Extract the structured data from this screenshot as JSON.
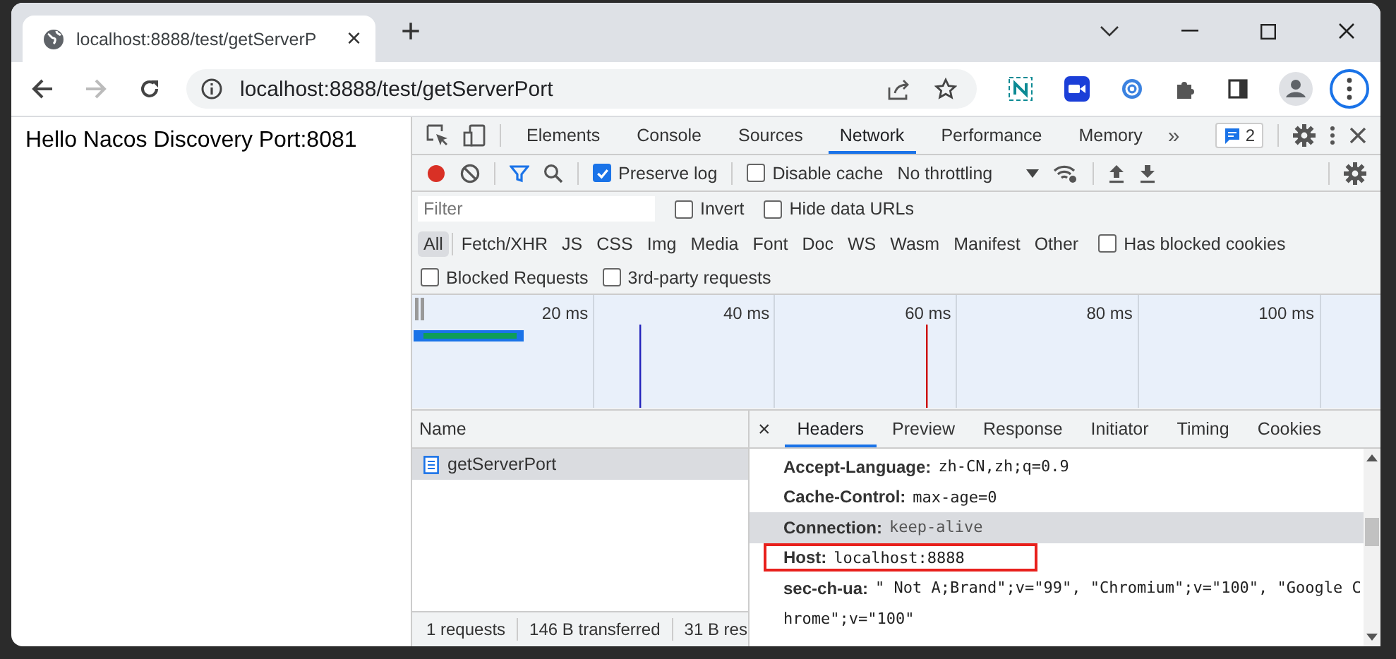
{
  "browser_tab": {
    "title": "localhost:8888/test/getServerP",
    "close": "×"
  },
  "new_tab": "+",
  "address": "localhost:8888/test/getServerPort",
  "page_text": "Hello Nacos Discovery Port:8081",
  "devtools": {
    "tabs": [
      {
        "label": "Elements",
        "selected": false
      },
      {
        "label": "Console",
        "selected": false
      },
      {
        "label": "Sources",
        "selected": false
      },
      {
        "label": "Network",
        "selected": true
      },
      {
        "label": "Performance",
        "selected": false
      },
      {
        "label": "Memory",
        "selected": false
      }
    ],
    "more": "»",
    "issues_count": "2",
    "recording": true,
    "preserve_log": {
      "label": "Preserve log",
      "checked": true
    },
    "disable_cache": {
      "label": "Disable cache",
      "checked": false
    },
    "throttling": "No throttling",
    "filter": {
      "placeholder": "Filter"
    },
    "invert": {
      "label": "Invert",
      "checked": false
    },
    "hide_data_urls": {
      "label": "Hide data URLs",
      "checked": false
    },
    "type_filters": [
      {
        "label": "All",
        "selected": true
      },
      {
        "label": "Fetch/XHR",
        "selected": false
      },
      {
        "label": "JS",
        "selected": false
      },
      {
        "label": "CSS",
        "selected": false
      },
      {
        "label": "Img",
        "selected": false
      },
      {
        "label": "Media",
        "selected": false
      },
      {
        "label": "Font",
        "selected": false
      },
      {
        "label": "Doc",
        "selected": false
      },
      {
        "label": "WS",
        "selected": false
      },
      {
        "label": "Wasm",
        "selected": false
      },
      {
        "label": "Manifest",
        "selected": false
      },
      {
        "label": "Other",
        "selected": false
      }
    ],
    "has_blocked_cookies": {
      "label": "Has blocked cookies",
      "checked": false
    },
    "blocked_requests": {
      "label": "Blocked Requests",
      "checked": false
    },
    "third_party": {
      "label": "3rd-party requests",
      "checked": false
    },
    "timeline_ticks": [
      "20 ms",
      "40 ms",
      "60 ms",
      "80 ms",
      "100 ms"
    ],
    "name_column": "Name",
    "requests": [
      {
        "name": "getServerPort",
        "selected": true
      }
    ],
    "detail_close": "×",
    "detail_tabs": [
      {
        "label": "Headers",
        "selected": true
      },
      {
        "label": "Preview",
        "selected": false
      },
      {
        "label": "Response",
        "selected": false
      },
      {
        "label": "Initiator",
        "selected": false
      },
      {
        "label": "Timing",
        "selected": false
      },
      {
        "label": "Cookies",
        "selected": false
      }
    ],
    "headers": [
      {
        "name": "Accept-Language:",
        "value": "zh-CN,zh;q=0.9",
        "hovered": false,
        "outlined": false
      },
      {
        "name": "Cache-Control:",
        "value": "max-age=0",
        "hovered": false,
        "outlined": false
      },
      {
        "name": "Connection:",
        "value": "keep-alive",
        "hovered": true,
        "outlined": false
      },
      {
        "name": "Host:",
        "value": "localhost:8888",
        "hovered": false,
        "outlined": true
      },
      {
        "name": "sec-ch-ua:",
        "value": "\" Not A;Brand\";v=\"99\", \"Chromium\";v=\"100\", \"Google C",
        "continuation": "hrome\";v=\"100\"",
        "hovered": false,
        "outlined": false
      }
    ],
    "status": [
      "1 requests",
      "146 B transferred",
      "31 B res"
    ]
  }
}
